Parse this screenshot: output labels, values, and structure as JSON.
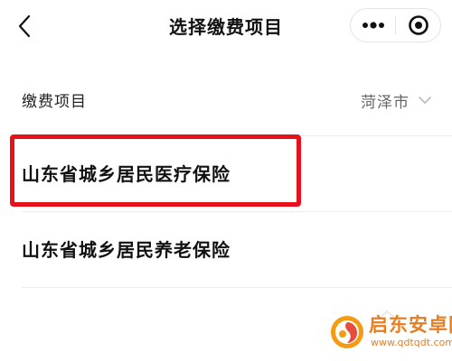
{
  "navbar": {
    "title": "选择缴费项目",
    "back_icon": "chevron-left-icon",
    "more_icon": "more-dots-icon",
    "close_icon": "mini-program-close-icon"
  },
  "header": {
    "label": "缴费项目",
    "city": "菏泽市",
    "city_icon": "chevron-down-icon"
  },
  "items": [
    {
      "label": "山东省城乡居民医疗保险",
      "highlighted": true
    },
    {
      "label": "山东省城乡居民养老保险",
      "highlighted": false
    }
  ],
  "colors": {
    "highlight": "#e8101a",
    "watermark": "#e67e22"
  },
  "watermark": {
    "text": "启东安卓网",
    "url": "www.qdtqdt.com"
  }
}
